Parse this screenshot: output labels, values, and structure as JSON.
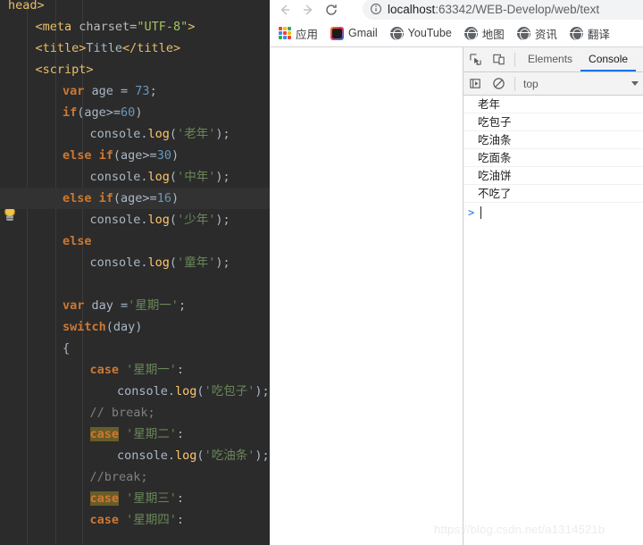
{
  "ide": {
    "name": "code-editor",
    "theme": "darcula",
    "background": "#2b2b2b",
    "gutter_icon": "lightbulb-icon",
    "current_line_index": 9,
    "colors": {
      "keyword": "#cc7832",
      "string": "#6a8759",
      "number": "#6897bb",
      "function": "#ffc66d",
      "comment": "#808080",
      "identifier": "#a9b7c6",
      "tag": "#e8bf6a",
      "attribute_value": "#a5c261",
      "search_highlight": "#695c28",
      "current_line": "#323232"
    },
    "lines": [
      {
        "indent": 0,
        "tokens": [
          {
            "t": "tag",
            "v": "head>"
          }
        ]
      },
      {
        "indent": 1,
        "tokens": [
          {
            "t": "tag",
            "v": "<meta "
          },
          {
            "t": "attr",
            "v": "charset="
          },
          {
            "t": "val",
            "v": "\"UTF-8\""
          },
          {
            "t": "tag",
            "v": ">"
          }
        ]
      },
      {
        "indent": 1,
        "tokens": [
          {
            "t": "tag",
            "v": "<title>"
          },
          {
            "t": "id",
            "v": "Title"
          },
          {
            "t": "tag",
            "v": "</title>"
          }
        ]
      },
      {
        "indent": 1,
        "tokens": [
          {
            "t": "tag",
            "v": "<script>"
          }
        ]
      },
      {
        "indent": 2,
        "tokens": [
          {
            "t": "k",
            "v": "var"
          },
          {
            "t": "id",
            "v": " age = "
          },
          {
            "t": "num",
            "v": "73"
          },
          {
            "t": "id",
            "v": ";"
          }
        ]
      },
      {
        "indent": 2,
        "tokens": [
          {
            "t": "k",
            "v": "if"
          },
          {
            "t": "id",
            "v": "(age>="
          },
          {
            "t": "num",
            "v": "60"
          },
          {
            "t": "id",
            "v": ")"
          }
        ]
      },
      {
        "indent": 3,
        "tokens": [
          {
            "t": "id",
            "v": "console."
          },
          {
            "t": "fn",
            "v": "log"
          },
          {
            "t": "id",
            "v": "("
          },
          {
            "t": "str",
            "v": "'老年'"
          },
          {
            "t": "id",
            "v": ");"
          }
        ]
      },
      {
        "indent": 2,
        "tokens": [
          {
            "t": "k",
            "v": "else if"
          },
          {
            "t": "id",
            "v": "(age>="
          },
          {
            "t": "num",
            "v": "30"
          },
          {
            "t": "id",
            "v": ")"
          }
        ]
      },
      {
        "indent": 3,
        "tokens": [
          {
            "t": "id",
            "v": "console."
          },
          {
            "t": "fn",
            "v": "log"
          },
          {
            "t": "id",
            "v": "("
          },
          {
            "t": "str",
            "v": "'中年'"
          },
          {
            "t": "id",
            "v": ");"
          }
        ]
      },
      {
        "indent": 2,
        "tokens": [
          {
            "t": "k",
            "v": "else if"
          },
          {
            "t": "id",
            "v": "(age>="
          },
          {
            "t": "num",
            "v": "16"
          },
          {
            "t": "id",
            "v": ")"
          }
        ]
      },
      {
        "indent": 3,
        "tokens": [
          {
            "t": "id",
            "v": "console."
          },
          {
            "t": "fn",
            "v": "log"
          },
          {
            "t": "id",
            "v": "("
          },
          {
            "t": "str",
            "v": "'少年'"
          },
          {
            "t": "id",
            "v": ");"
          }
        ]
      },
      {
        "indent": 2,
        "tokens": [
          {
            "t": "k",
            "v": "else"
          }
        ]
      },
      {
        "indent": 3,
        "tokens": [
          {
            "t": "id",
            "v": "console."
          },
          {
            "t": "fn",
            "v": "log"
          },
          {
            "t": "id",
            "v": "("
          },
          {
            "t": "str",
            "v": "'童年'"
          },
          {
            "t": "id",
            "v": ");"
          }
        ]
      },
      {
        "indent": 0,
        "tokens": []
      },
      {
        "indent": 2,
        "tokens": [
          {
            "t": "k",
            "v": "var"
          },
          {
            "t": "id",
            "v": " day ="
          },
          {
            "t": "str",
            "v": "'星期一'"
          },
          {
            "t": "id",
            "v": ";"
          }
        ]
      },
      {
        "indent": 2,
        "tokens": [
          {
            "t": "k",
            "v": "switch"
          },
          {
            "t": "id",
            "v": "(day)"
          }
        ]
      },
      {
        "indent": 2,
        "tokens": [
          {
            "t": "id",
            "v": "{"
          }
        ]
      },
      {
        "indent": 3,
        "tokens": [
          {
            "t": "k",
            "v": "case"
          },
          {
            "t": "str",
            "v": " '星期一'"
          },
          {
            "t": "id",
            "v": ":"
          }
        ]
      },
      {
        "indent": 4,
        "tokens": [
          {
            "t": "id",
            "v": "console."
          },
          {
            "t": "fn",
            "v": "log"
          },
          {
            "t": "id",
            "v": "("
          },
          {
            "t": "str",
            "v": "'吃包子'"
          },
          {
            "t": "id",
            "v": ");"
          }
        ]
      },
      {
        "indent": 3,
        "tokens": [
          {
            "t": "cmt",
            "v": "// break;"
          }
        ]
      },
      {
        "indent": 3,
        "tokens": [
          {
            "t": "k hl",
            "v": "case"
          },
          {
            "t": "str",
            "v": " '星期二'"
          },
          {
            "t": "id",
            "v": ":"
          }
        ]
      },
      {
        "indent": 4,
        "tokens": [
          {
            "t": "id",
            "v": "console."
          },
          {
            "t": "fn",
            "v": "log"
          },
          {
            "t": "id",
            "v": "("
          },
          {
            "t": "str",
            "v": "'吃油条'"
          },
          {
            "t": "id",
            "v": ");"
          }
        ]
      },
      {
        "indent": 3,
        "tokens": [
          {
            "t": "cmt",
            "v": "//break;"
          }
        ]
      },
      {
        "indent": 3,
        "tokens": [
          {
            "t": "k hl",
            "v": "case"
          },
          {
            "t": "str",
            "v": " '星期三'"
          },
          {
            "t": "id",
            "v": ":"
          }
        ]
      },
      {
        "indent": 3,
        "tokens": [
          {
            "t": "k",
            "v": "case"
          },
          {
            "t": "str",
            "v": " '星期四'"
          },
          {
            "t": "id",
            "v": ":"
          }
        ]
      }
    ]
  },
  "browser": {
    "nav": {
      "back_icon": "arrow-left-icon",
      "forward_icon": "arrow-right-icon",
      "reload_icon": "reload-icon"
    },
    "address_bar": {
      "info_icon": "info-circle-icon",
      "url_prefix": "localhost",
      "url_suffix": ":63342/WEB-Develop/web/text",
      "full_url": "localhost:63342/WEB-Develop/web/text"
    },
    "bookmarks": [
      {
        "label": "应用",
        "icon": "apps-grid-icon"
      },
      {
        "label": "Gmail",
        "icon": "jetbrains-icon"
      },
      {
        "label": "YouTube",
        "icon": "globe-icon"
      },
      {
        "label": "地图",
        "icon": "globe-icon"
      },
      {
        "label": "资讯",
        "icon": "globe-icon"
      },
      {
        "label": "翻译",
        "icon": "globe-icon"
      }
    ]
  },
  "devtools": {
    "left_icons": [
      {
        "name": "inspect-element-icon"
      },
      {
        "name": "device-toolbar-icon"
      }
    ],
    "tabs": [
      {
        "label": "Elements",
        "active": false
      },
      {
        "label": "Console",
        "active": true
      }
    ],
    "toolbar2": {
      "execute_icon": "step-into-icon",
      "clear_icon": "clear-console-icon",
      "context": "top",
      "caret_icon": "chevron-down-icon"
    },
    "console": {
      "messages": [
        "老年",
        "吃包子",
        "吃油条",
        "吃面条",
        "吃油饼",
        "不吃了"
      ],
      "prompt_symbol": ">",
      "prompt_value": ""
    },
    "accent_color": "#1a73e8"
  },
  "watermark": {
    "text": "https://blog.csdn.net/a1314521b"
  }
}
